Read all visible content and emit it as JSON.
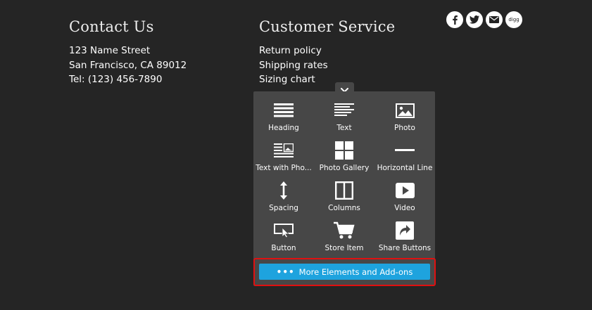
{
  "contact": {
    "heading": "Contact Us",
    "street": "123 Name Street",
    "city": "San Francisco, CA 89012",
    "phone": "Tel: (123) 456-7890"
  },
  "service": {
    "heading": "Customer Service",
    "links": [
      "Return policy",
      "Shipping rates",
      "Sizing chart"
    ]
  },
  "social": {
    "icons": [
      "facebook-icon",
      "twitter-icon",
      "email-icon",
      "digg-icon"
    ],
    "digg_label": "digg"
  },
  "panel": {
    "close_icon": "close-icon",
    "items": [
      {
        "label": "Heading",
        "icon": "heading-icon"
      },
      {
        "label": "Text",
        "icon": "text-icon"
      },
      {
        "label": "Photo",
        "icon": "photo-icon"
      },
      {
        "label": "Text with Pho...",
        "icon": "text-with-photo-icon"
      },
      {
        "label": "Photo Gallery",
        "icon": "photo-gallery-icon"
      },
      {
        "label": "Horizontal Line",
        "icon": "horizontal-line-icon"
      },
      {
        "label": "Spacing",
        "icon": "spacing-icon"
      },
      {
        "label": "Columns",
        "icon": "columns-icon"
      },
      {
        "label": "Video",
        "icon": "video-icon"
      },
      {
        "label": "Button",
        "icon": "button-icon"
      },
      {
        "label": "Store Item",
        "icon": "store-item-icon"
      },
      {
        "label": "Share Buttons",
        "icon": "share-buttons-icon"
      }
    ],
    "more_label": "More Elements and Add-ons",
    "more_dots": "•••"
  },
  "colors": {
    "background": "#252525",
    "panel": "#474747",
    "accent": "#1ea3de",
    "highlight": "#e01010"
  }
}
